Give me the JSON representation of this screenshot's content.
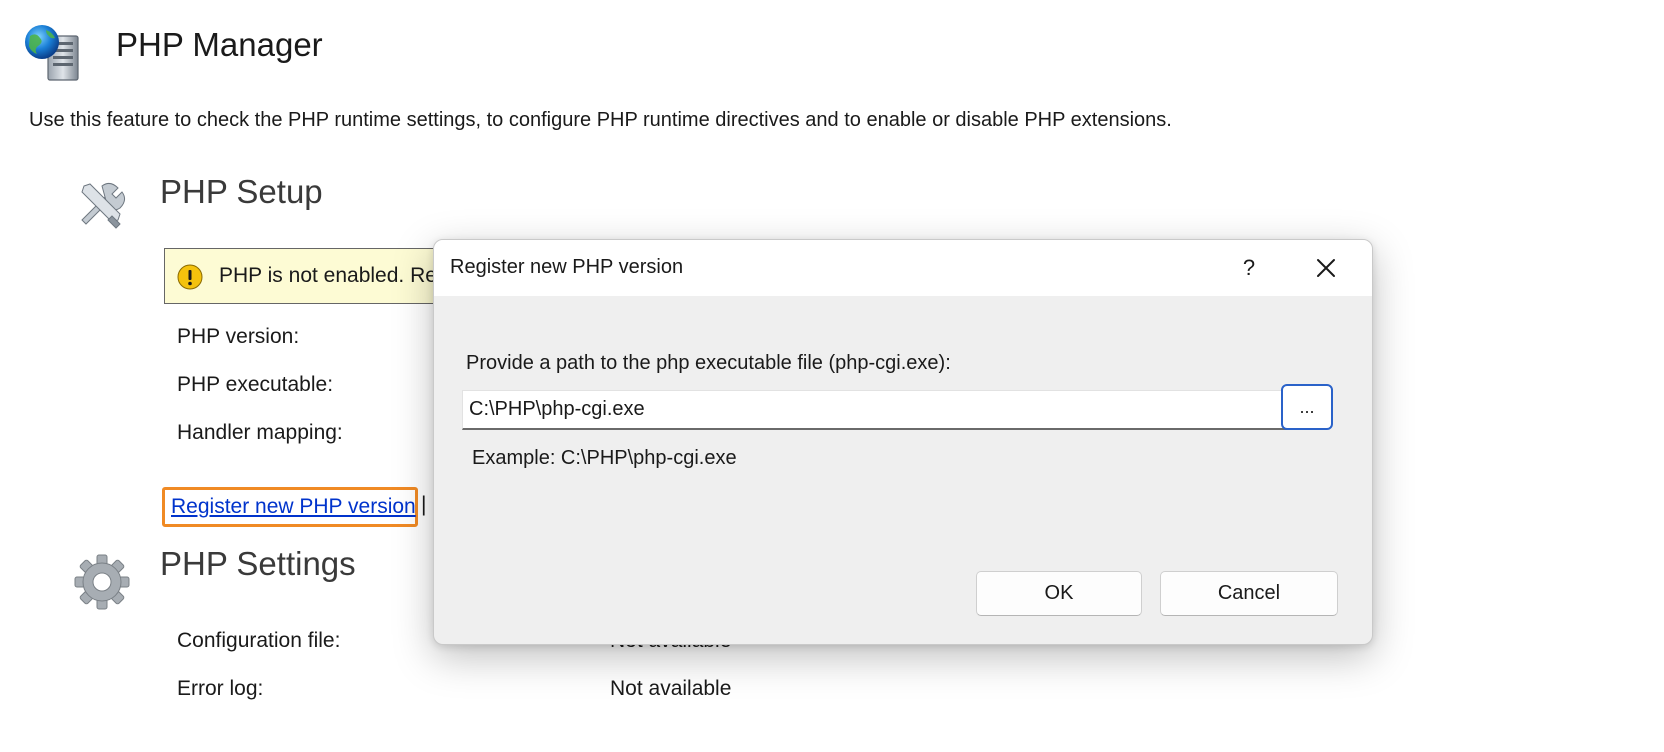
{
  "header": {
    "title": "PHP Manager",
    "icon": "php-manager-icon",
    "description": "Use this feature to check the PHP runtime settings, to configure PHP runtime directives and to enable or disable PHP extensions."
  },
  "php_setup": {
    "title": "PHP Setup",
    "icon": "tools-icon",
    "warning_text": "PHP is not enabled. Re",
    "rows": [
      {
        "label": "PHP version:"
      },
      {
        "label": "PHP executable:"
      },
      {
        "label": "Handler mapping:"
      }
    ],
    "register_link": "Register new PHP version",
    "separator": "|"
  },
  "php_settings": {
    "title": "PHP Settings",
    "icon": "gear-icon",
    "rows": [
      {
        "label": "Configuration file:",
        "value": "Not available"
      },
      {
        "label": "Error log:",
        "value": "Not available"
      }
    ]
  },
  "dialog": {
    "title": "Register new PHP version",
    "help_label": "?",
    "prompt": "Provide a path to the php executable file (php-cgi.exe):",
    "path_value": "C:\\PHP\\php-cgi.exe",
    "browse_label": "...",
    "example": "Example: C:\\PHP\\php-cgi.exe",
    "ok_label": "OK",
    "cancel_label": "Cancel"
  },
  "colors": {
    "link": "#0033cc",
    "highlight": "#f08a24",
    "warning_bg": "#fdfbd4",
    "focus_blue": "#2a62c9"
  }
}
